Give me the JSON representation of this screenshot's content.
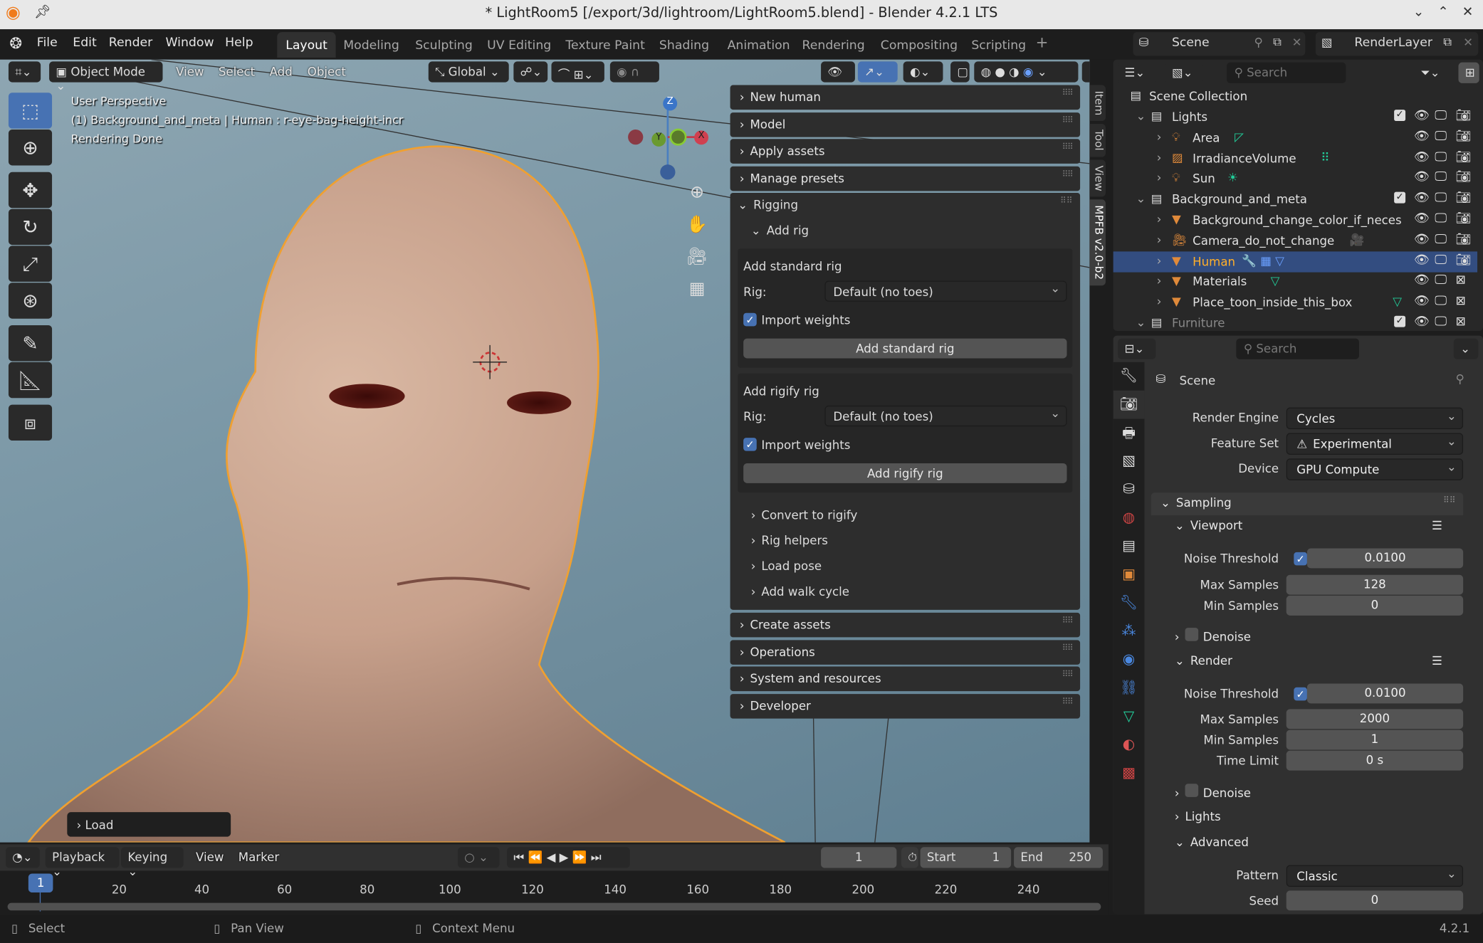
{
  "window": {
    "title": "* LightRoom5 [/export/3d/lightroom/LightRoom5.blend] - Blender 4.2.1 LTS",
    "controls": [
      "⌄",
      "⌃",
      "✕"
    ]
  },
  "menu": {
    "items": [
      "File",
      "Edit",
      "Render",
      "Window",
      "Help"
    ],
    "workspaces": [
      "Layout",
      "Modeling",
      "Sculpting",
      "UV Editing",
      "Texture Paint",
      "Shading",
      "Animation",
      "Rendering",
      "Compositing",
      "Scripting"
    ],
    "active_workspace": "Layout",
    "add": "+"
  },
  "scene_selector": {
    "scene": "Scene",
    "view_layer": "RenderLayer"
  },
  "viewport_header": {
    "mode": "Object Mode",
    "menus": [
      "View",
      "Select",
      "Add",
      "Object"
    ],
    "orientation": "Global"
  },
  "viewport": {
    "info": [
      "User Perspective",
      "(1) Background_and_meta | Human : r-eye-bag-height-incr",
      "Rendering Done"
    ],
    "gizmo": {
      "z": "Z",
      "y": "Y",
      "x": "X"
    },
    "operator_panel": "Load",
    "selection_outline_color": "#f0a030"
  },
  "tools": [
    "select-box",
    "cursor",
    "move",
    "rotate",
    "scale",
    "transform",
    "annotate",
    "measure",
    "add-cube"
  ],
  "npanel": {
    "sections_top": [
      "New human",
      "Model",
      "Apply assets",
      "Manage presets"
    ],
    "rigging": {
      "title": "Rigging",
      "add_rig": "Add rig",
      "standard": {
        "title": "Add standard rig",
        "rig_label": "Rig:",
        "rig_value": "Default (no toes)",
        "import_weights": "Import weights",
        "button": "Add standard rig"
      },
      "rigify": {
        "title": "Add rigify rig",
        "rig_label": "Rig:",
        "rig_value": "Default (no toes)",
        "import_weights": "Import weights",
        "button": "Add rigify rig"
      },
      "subsections": [
        "Convert to rigify",
        "Rig helpers",
        "Load pose",
        "Add walk cycle"
      ]
    },
    "sections_bottom": [
      "Create assets",
      "Operations",
      "System and resources",
      "Developer"
    ],
    "tabs": [
      "Item",
      "Tool",
      "View",
      "MPFB v2.0-b2"
    ],
    "active_tab": "MPFB v2.0-b2"
  },
  "outliner": {
    "search_placeholder": "Search",
    "root": "Scene Collection",
    "rows": [
      {
        "name": "Lights",
        "depth": 0,
        "kind": "collection",
        "expanded": true,
        "checkbox": true
      },
      {
        "name": "Area",
        "depth": 1,
        "kind": "light",
        "extra": "◸"
      },
      {
        "name": "IrradianceVolume",
        "depth": 1,
        "kind": "probe",
        "extra": "⠿"
      },
      {
        "name": "Sun",
        "depth": 1,
        "kind": "light",
        "extra": "☀"
      },
      {
        "name": "Background_and_meta",
        "depth": 0,
        "kind": "collection",
        "expanded": true,
        "checkbox": true
      },
      {
        "name": "Background_change_color_if_neces",
        "depth": 1,
        "kind": "mesh"
      },
      {
        "name": "Camera_do_not_change",
        "depth": 1,
        "kind": "camera",
        "extra": "🎥"
      },
      {
        "name": "Human",
        "depth": 1,
        "kind": "mesh",
        "selected": true,
        "extra": "🔧 ▦ ▽"
      },
      {
        "name": "Materials",
        "depth": 1,
        "kind": "mesh",
        "extra": "▽",
        "render_off": true
      },
      {
        "name": "Place_toon_inside_this_box",
        "depth": 1,
        "kind": "mesh",
        "extra": "▽",
        "render_off": true
      },
      {
        "name": "Furniture",
        "depth": 0,
        "kind": "collection",
        "expanded": true,
        "checkbox": true,
        "dim": true,
        "render_off": true
      }
    ]
  },
  "properties": {
    "search_placeholder": "Search",
    "context": "Scene",
    "rows": [
      {
        "type": "dropdown",
        "label": "Render Engine",
        "value": "Cycles"
      },
      {
        "type": "dropdown",
        "label": "Feature Set",
        "value": "Experimental",
        "warning": true
      },
      {
        "type": "dropdown",
        "label": "Device",
        "value": "GPU Compute"
      },
      {
        "type": "panel",
        "label": "Sampling",
        "level": 0,
        "expanded": true
      },
      {
        "type": "panel",
        "label": "Viewport",
        "level": 1,
        "expanded": true,
        "presets": true
      },
      {
        "type": "number",
        "label": "Noise Threshold",
        "value": "0.0100",
        "checkbox": true
      },
      {
        "type": "number",
        "label": "Max Samples",
        "value": "128"
      },
      {
        "type": "number",
        "label": "Min Samples",
        "value": "0"
      },
      {
        "type": "panel",
        "label": "Denoise",
        "level": 1,
        "expanded": false,
        "checkbox": false
      },
      {
        "type": "panel",
        "label": "Render",
        "level": 1,
        "expanded": true,
        "presets": true
      },
      {
        "type": "number",
        "label": "Noise Threshold",
        "value": "0.0100",
        "checkbox": true
      },
      {
        "type": "number",
        "label": "Max Samples",
        "value": "2000"
      },
      {
        "type": "number",
        "label": "Min Samples",
        "value": "1"
      },
      {
        "type": "number",
        "label": "Time Limit",
        "value": "0 s"
      },
      {
        "type": "panel",
        "label": "Denoise",
        "level": 1,
        "expanded": false,
        "checkbox": false
      },
      {
        "type": "panel",
        "label": "Lights",
        "level": 1,
        "expanded": false
      },
      {
        "type": "panel",
        "label": "Advanced",
        "level": 1,
        "expanded": true
      },
      {
        "type": "dropdown",
        "label": "Pattern",
        "value": "Classic"
      },
      {
        "type": "number",
        "label": "Seed",
        "value": "0"
      }
    ]
  },
  "timeline": {
    "menus": [
      "Playback",
      "Keying",
      "View",
      "Marker"
    ],
    "current_frame": "1",
    "start_label": "Start",
    "start": "1",
    "end_label": "End",
    "end": "250",
    "ticks": [
      "20",
      "40",
      "60",
      "80",
      "100",
      "120",
      "140",
      "160",
      "180",
      "200",
      "220",
      "240"
    ]
  },
  "status": {
    "items": [
      "Select",
      "Pan View",
      "Context Menu"
    ],
    "version": "4.2.1"
  }
}
